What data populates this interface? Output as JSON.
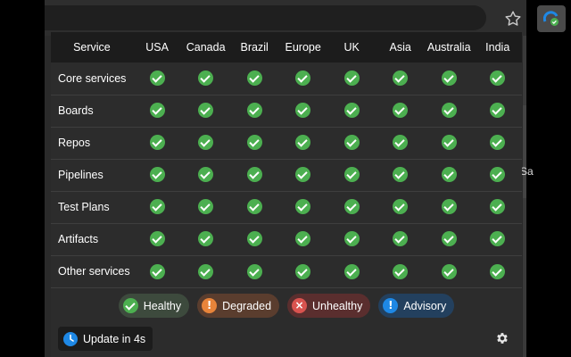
{
  "table": {
    "header": [
      "Service",
      "USA",
      "Canada",
      "Brazil",
      "Europe",
      "UK",
      "Asia",
      "Australia",
      "India"
    ],
    "rows": [
      {
        "service": "Core services",
        "statuses": [
          "healthy",
          "healthy",
          "healthy",
          "healthy",
          "healthy",
          "healthy",
          "healthy",
          "healthy"
        ]
      },
      {
        "service": "Boards",
        "statuses": [
          "healthy",
          "healthy",
          "healthy",
          "healthy",
          "healthy",
          "healthy",
          "healthy",
          "healthy"
        ]
      },
      {
        "service": "Repos",
        "statuses": [
          "healthy",
          "healthy",
          "healthy",
          "healthy",
          "healthy",
          "healthy",
          "healthy",
          "healthy"
        ]
      },
      {
        "service": "Pipelines",
        "statuses": [
          "healthy",
          "healthy",
          "healthy",
          "healthy",
          "healthy",
          "healthy",
          "healthy",
          "healthy"
        ]
      },
      {
        "service": "Test Plans",
        "statuses": [
          "healthy",
          "healthy",
          "healthy",
          "healthy",
          "healthy",
          "healthy",
          "healthy",
          "healthy"
        ]
      },
      {
        "service": "Artifacts",
        "statuses": [
          "healthy",
          "healthy",
          "healthy",
          "healthy",
          "healthy",
          "healthy",
          "healthy",
          "healthy"
        ]
      },
      {
        "service": "Other services",
        "statuses": [
          "healthy",
          "healthy",
          "healthy",
          "healthy",
          "healthy",
          "healthy",
          "healthy",
          "healthy"
        ]
      }
    ]
  },
  "legend": {
    "healthy": "Healthy",
    "degraded": "Degraded",
    "unhealthy": "Unhealthy",
    "advisory": "Advisory"
  },
  "footer": {
    "update_label": "Update in 4s"
  },
  "background": {
    "fragment_text": "Sa"
  },
  "colors": {
    "healthy": "#4caf50",
    "degraded": "#e8843a",
    "unhealthy": "#d9534f",
    "advisory": "#1e88e5"
  },
  "icons": {
    "bookmark": "star-icon",
    "extension": "azure-devops-status-icon",
    "settings": "gear-icon",
    "update": "clock-icon"
  }
}
